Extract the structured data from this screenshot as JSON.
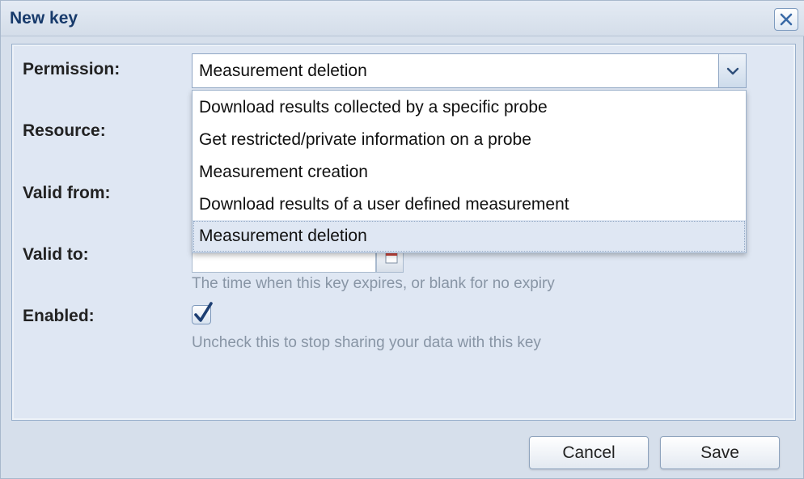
{
  "dialog": {
    "title": "New key",
    "close_icon": "close-icon"
  },
  "form": {
    "permission_label": "Permission:",
    "resource_label": "Resource:",
    "valid_from_label": "Valid from:",
    "valid_to_label": "Valid to:",
    "enabled_label": "Enabled:",
    "permission_value": "Measurement deletion",
    "valid_to_value": "",
    "valid_to_hint": "The time when this key expires, or blank for no expiry",
    "enabled_checked": true,
    "enabled_hint": "Uncheck this to stop sharing your data with this key"
  },
  "dropdown": {
    "options": [
      "Download results collected by a specific probe",
      "Get restricted/private information on a probe",
      "Measurement creation",
      "Download results of a user defined measurement",
      "Measurement deletion"
    ],
    "selected_index": 4
  },
  "buttons": {
    "cancel": "Cancel",
    "save": "Save"
  },
  "colors": {
    "title": "#173a6b",
    "hint": "#8895a5",
    "check": "#1d3f73"
  }
}
